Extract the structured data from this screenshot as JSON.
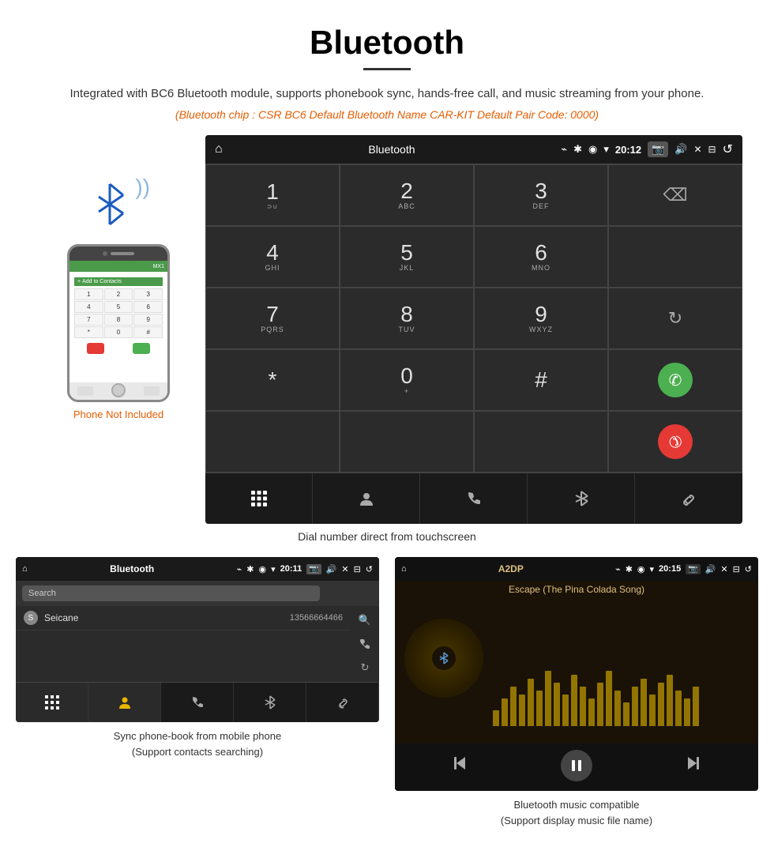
{
  "page": {
    "title": "Bluetooth",
    "subtitle": "Integrated with BC6 Bluetooth module, supports phonebook sync, hands-free call, and music streaming from your phone.",
    "chip_info": "(Bluetooth chip : CSR BC6    Default Bluetooth Name CAR-KIT    Default Pair Code: 0000)",
    "dial_caption": "Dial number direct from touchscreen",
    "phonebook_caption": "Sync phone-book from mobile phone\n(Support contacts searching)",
    "music_caption": "Bluetooth music compatible\n(Support display music file name)"
  },
  "status_bar": {
    "title": "Bluetooth",
    "time": "20:12",
    "usb_icon": "⌁"
  },
  "status_bar2": {
    "title": "Bluetooth",
    "time": "20:11"
  },
  "status_bar3": {
    "title": "A2DP",
    "time": "20:15"
  },
  "phone_mockup": {
    "keys": [
      "1",
      "2",
      "3",
      "4",
      "5",
      "6",
      "7",
      "8",
      "9",
      "*",
      "0",
      "#"
    ],
    "not_included": "Phone Not Included"
  },
  "keypad": {
    "keys": [
      {
        "num": "1",
        "sub": ""
      },
      {
        "num": "2",
        "sub": "ABC"
      },
      {
        "num": "3",
        "sub": "DEF"
      },
      {
        "num": "backspace",
        "sub": ""
      },
      {
        "num": "4",
        "sub": "GHI"
      },
      {
        "num": "5",
        "sub": "JKL"
      },
      {
        "num": "6",
        "sub": "MNO"
      },
      {
        "num": "",
        "sub": ""
      },
      {
        "num": "7",
        "sub": "PQRS"
      },
      {
        "num": "8",
        "sub": "TUV"
      },
      {
        "num": "9",
        "sub": "WXYZ"
      },
      {
        "num": "refresh",
        "sub": ""
      },
      {
        "num": "*",
        "sub": ""
      },
      {
        "num": "0",
        "sub": "+"
      },
      {
        "num": "#",
        "sub": ""
      },
      {
        "num": "call_green",
        "sub": ""
      },
      {
        "num": "",
        "sub": ""
      },
      {
        "num": "",
        "sub": ""
      },
      {
        "num": "",
        "sub": ""
      },
      {
        "num": "call_red",
        "sub": ""
      }
    ]
  },
  "nav_bar": {
    "items": [
      "⊞",
      "👤",
      "📞",
      "✱",
      "🔗"
    ]
  },
  "phonebook": {
    "search_placeholder": "Search",
    "contact_name": "Seicane",
    "contact_number": "13566664466"
  },
  "music": {
    "song_title": "Escape (The Pina Colada Song)",
    "viz_heights": [
      20,
      35,
      50,
      40,
      60,
      45,
      70,
      55,
      40,
      65,
      50,
      35,
      55,
      70,
      45,
      30,
      50,
      60,
      40,
      55,
      65,
      45,
      35,
      50
    ]
  }
}
